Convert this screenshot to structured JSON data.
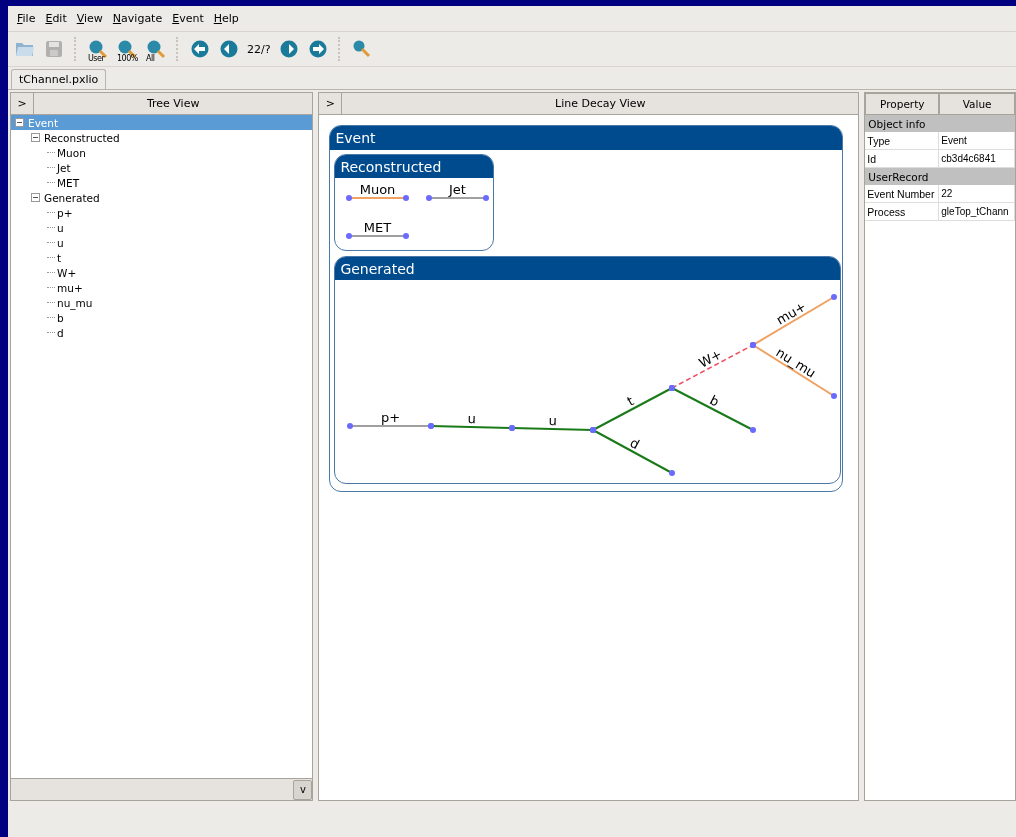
{
  "menu": [
    "File",
    "Edit",
    "View",
    "Navigate",
    "Event",
    "Help"
  ],
  "toolbar": [
    {
      "kind": "open"
    },
    {
      "kind": "save",
      "disabled": true
    },
    {
      "kind": "sep"
    },
    {
      "kind": "zoom",
      "label": "User"
    },
    {
      "kind": "zoom",
      "label": "100%"
    },
    {
      "kind": "zoom",
      "label": "All"
    },
    {
      "kind": "sep"
    },
    {
      "kind": "first"
    },
    {
      "kind": "prev"
    },
    {
      "kind": "counter",
      "label": "22/?"
    },
    {
      "kind": "next"
    },
    {
      "kind": "last"
    },
    {
      "kind": "sep"
    },
    {
      "kind": "tool"
    }
  ],
  "tabs": [
    {
      "label": "tChannel.pxlio",
      "selected": true
    }
  ],
  "tree_view": {
    "toggle": ">",
    "title": "Tree View",
    "bottom_toggle": "v",
    "items": [
      {
        "label": "Event",
        "selected": true,
        "expanded": true,
        "children": [
          {
            "label": "Reconstructed",
            "selected": false,
            "expanded": true,
            "children": [
              {
                "label": "Muon",
                "selected": false
              },
              {
                "label": "Jet",
                "selected": false
              },
              {
                "label": "MET",
                "selected": false
              }
            ]
          },
          {
            "label": "Generated",
            "selected": false,
            "expanded": true,
            "children": [
              {
                "label": "p+",
                "selected": false
              },
              {
                "label": "u",
                "selected": false
              },
              {
                "label": "u",
                "selected": false
              },
              {
                "label": "t",
                "selected": false
              },
              {
                "label": "W+",
                "selected": false
              },
              {
                "label": "mu+",
                "selected": false
              },
              {
                "label": "nu_mu",
                "selected": false
              },
              {
                "label": "b",
                "selected": false
              },
              {
                "label": "d",
                "selected": false
              }
            ]
          }
        ]
      }
    ]
  },
  "decay_view": {
    "toggle": ">",
    "title": "Line Decay View",
    "event": {
      "title": "Event",
      "reconstructed": {
        "title": "Reconstructed",
        "particles": [
          {
            "label": "Muon",
            "color": "#f0a060"
          },
          {
            "label": "Jet",
            "color": "#a0a0a0"
          },
          {
            "label": "MET",
            "color": "#a0a0a0"
          }
        ]
      },
      "generated": {
        "title": "Generated",
        "particles": [
          {
            "label": "p+",
            "color": "#a0a0a0",
            "dashed": false
          },
          {
            "label": "u",
            "color": "#1a7a1a",
            "dashed": false
          },
          {
            "label": "u",
            "color": "#1a7a1a",
            "dashed": false
          },
          {
            "label": "t",
            "color": "#1a7a1a",
            "dashed": false
          },
          {
            "label": "d",
            "color": "#1a7a1a",
            "dashed": false
          },
          {
            "label": "W+",
            "color": "#f05060",
            "dashed": true
          },
          {
            "label": "b",
            "color": "#1a7a1a",
            "dashed": false
          },
          {
            "label": "mu+",
            "color": "#f0a060",
            "dashed": false
          },
          {
            "label": "nu_mu",
            "color": "#f0a060",
            "dashed": false
          }
        ]
      }
    }
  },
  "properties": {
    "columns": [
      "Property",
      "Value"
    ],
    "groups": [
      {
        "title": "Object info",
        "rows": [
          [
            "Type",
            "Event"
          ],
          [
            "Id",
            "cb3d4c6841"
          ]
        ]
      },
      {
        "title": "UserRecord",
        "rows": [
          [
            "Event Number",
            "22"
          ],
          [
            "Process",
            "gleTop_tChann"
          ]
        ]
      }
    ]
  }
}
